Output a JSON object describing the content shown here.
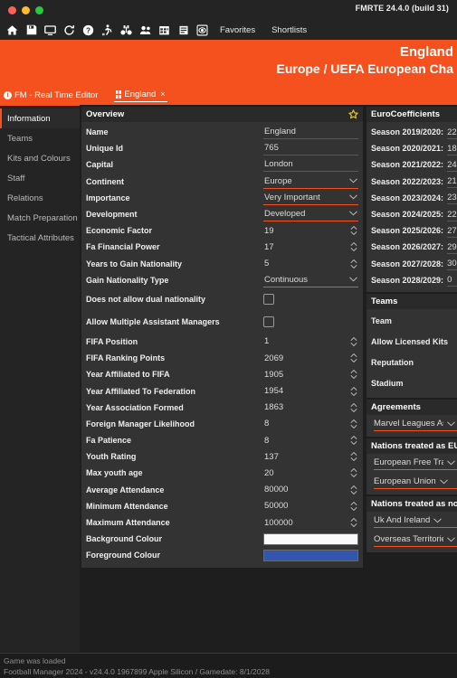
{
  "window": {
    "app_version": "FMRTE 24.4.0 (build 31)",
    "traffic_lights": [
      "close",
      "minimize",
      "maximize"
    ]
  },
  "toolbar": {
    "icons": [
      {
        "name": "home-icon",
        "label": "Home"
      },
      {
        "name": "save-icon",
        "label": "Save"
      },
      {
        "name": "monitor-icon",
        "label": "Monitor"
      },
      {
        "name": "refresh-icon",
        "label": "Refresh"
      },
      {
        "name": "help-icon",
        "label": "Help"
      },
      {
        "name": "player-icon",
        "label": "Players"
      },
      {
        "name": "binoculars-icon",
        "label": "Scouting"
      },
      {
        "name": "people-icon",
        "label": "Staff"
      },
      {
        "name": "calendar-icon",
        "label": "Calendar"
      },
      {
        "name": "list-icon",
        "label": "List"
      },
      {
        "name": "stadium-icon",
        "label": "Stadium"
      }
    ],
    "favorites_label": "Favorites",
    "shortlists_label": "Shortlists"
  },
  "header": {
    "nation": "England",
    "competition": "Europe / UEFA European Cha"
  },
  "tabs": {
    "brand": "FM - Real Time Editor",
    "brand_badge": "i",
    "items": [
      {
        "label": "England",
        "close": "×"
      }
    ]
  },
  "sidebar": {
    "items": [
      {
        "label": "Information",
        "active": true
      },
      {
        "label": "Teams",
        "active": false
      },
      {
        "label": "Kits and Colours",
        "active": false
      },
      {
        "label": "Staff",
        "active": false
      },
      {
        "label": "Relations",
        "active": false
      },
      {
        "label": "Match Preparation",
        "active": false
      },
      {
        "label": "Tactical Attributes",
        "active": false
      }
    ]
  },
  "overview": {
    "title": "Overview",
    "star_icon": "star-icon",
    "fields": [
      {
        "label": "Name",
        "value": "England",
        "type": "text"
      },
      {
        "label": "Unique Id",
        "value": "765",
        "type": "text"
      },
      {
        "label": "Capital",
        "value": "London",
        "type": "text"
      },
      {
        "label": "Continent",
        "value": "Europe",
        "type": "select"
      },
      {
        "label": "Importance",
        "value": "Very Important",
        "type": "select"
      },
      {
        "label": "Development",
        "value": "Developed",
        "type": "select"
      },
      {
        "label": "Economic Factor",
        "value": "19",
        "type": "spinner"
      },
      {
        "label": "Fa Financial Power",
        "value": "17",
        "type": "spinner"
      },
      {
        "label": "Years to Gain Nationality",
        "value": "5",
        "type": "spinner"
      },
      {
        "label": "Gain Nationality Type",
        "value": "Continuous",
        "type": "select"
      },
      {
        "label": "Does not allow dual nationality",
        "value": "",
        "type": "checkbox",
        "checked": false
      },
      {
        "label": "Allow Multiple Assistant Managers",
        "value": "",
        "type": "checkbox",
        "checked": false
      },
      {
        "label": "FIFA Position",
        "value": "1",
        "type": "spinner"
      },
      {
        "label": "FIFA Ranking Points",
        "value": "2069",
        "type": "spinner"
      },
      {
        "label": "Year Affiliated to FIFA",
        "value": "1905",
        "type": "spinner"
      },
      {
        "label": "Year Affiliated To Federation",
        "value": "1954",
        "type": "spinner"
      },
      {
        "label": "Year Association Formed",
        "value": "1863",
        "type": "spinner"
      },
      {
        "label": "Foreign Manager Likelihood",
        "value": "8",
        "type": "spinner"
      },
      {
        "label": "Fa Patience",
        "value": "8",
        "type": "spinner"
      },
      {
        "label": "Youth Rating",
        "value": "137",
        "type": "spinner"
      },
      {
        "label": "Max youth age",
        "value": "20",
        "type": "spinner"
      },
      {
        "label": "Average Attendance",
        "value": "80000",
        "type": "spinner"
      },
      {
        "label": "Minimum Attendance",
        "value": "50000",
        "type": "spinner"
      },
      {
        "label": "Maximum Attendance",
        "value": "100000",
        "type": "spinner"
      },
      {
        "label": "Background Colour",
        "value": "",
        "type": "colour",
        "colour": "#fafafa"
      },
      {
        "label": "Foreground Colour",
        "value": "",
        "type": "colour",
        "colour": "#3256b0"
      }
    ]
  },
  "euro_coefficients": {
    "title": "EuroCoefficients",
    "rows": [
      {
        "label": "Season 2019/2020:",
        "value": "22"
      },
      {
        "label": "Season 2020/2021:",
        "value": "18"
      },
      {
        "label": "Season 2021/2022:",
        "value": "24"
      },
      {
        "label": "Season 2022/2023:",
        "value": "21"
      },
      {
        "label": "Season 2023/2024:",
        "value": "23"
      },
      {
        "label": "Season 2024/2025:",
        "value": "22"
      },
      {
        "label": "Season 2025/2026:",
        "value": "27"
      },
      {
        "label": "Season 2026/2027:",
        "value": "29"
      },
      {
        "label": "Season 2027/2028:",
        "value": "30"
      },
      {
        "label": "Season 2028/2029:",
        "value": "0"
      }
    ]
  },
  "teams_panel": {
    "title": "Teams",
    "rows": [
      {
        "label": "Team"
      },
      {
        "label": "Allow Licensed Kits"
      },
      {
        "label": "Reputation"
      },
      {
        "label": "Stadium"
      }
    ]
  },
  "agreements_panel": {
    "title": "Agreements",
    "selects": [
      {
        "value": "Marvel Leagues Asso"
      }
    ]
  },
  "eu_panel": {
    "title": "Nations treated as EU",
    "selects": [
      {
        "value": "European Free Trade"
      },
      {
        "value": "European Union"
      }
    ]
  },
  "non_eu_panel": {
    "title": "Nations treated as no",
    "selects": [
      {
        "value": "Uk And Ireland"
      },
      {
        "value": "Overseas Territories ."
      }
    ]
  },
  "statusbar": {
    "line1": "Game was loaded",
    "line2": "Football Manager 2024 - v24.4.0 1967899 Apple Silicon / Gamedate: 8/1/2028"
  },
  "colors": {
    "accent": "#f4511e",
    "panel": "#333333",
    "panel_head": "#2a2a2a",
    "app_bg": "#1e1e1e",
    "star": "#e6c319"
  }
}
